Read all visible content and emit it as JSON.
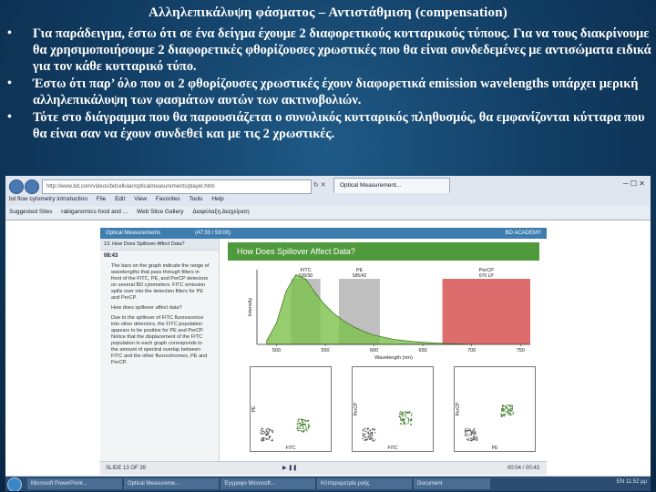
{
  "slide": {
    "title": "Αλληλεπικάλυψη φάσματος – Αντιστάθμιση (compensation)",
    "bullets": [
      "Για παράδειγμα, έστω ότι σε ένα δείγμα έχουμε 2 διαφορετικούς κυτταρικούς τύπους. Για να τους διακρίνουμε θα χρησιμοποιήσουμε 2 διαφορετικές φθορίζουσες χρωστικές που θα είναι συνδεδεμένες με αντισώματα ειδικά για τον κάθε κυτταρικό τύπο.",
      "Έστω ότι παρ’ όλο που οι 2 φθορίζουσες χρωστικές έχουν διαφορετικά emission wavelengths υπάρχει μερική αλληλεπικάλυψη των φασμάτων αυτών των ακτινοβολιών.",
      "Τότε στο διάγραμμα που θα παρουσιάζεται ο συνολικός κυτταρικός πληθυσμός, θα εμφανίζονται κύτταρα που θα είναι σαν να έχουν συνδεθεί και με τις 2 χρωστικές."
    ],
    "bullet_glyph": "•"
  },
  "browser": {
    "url": "http://www.bd.com/videos/bdcellular/opticalmeasurements/player.html",
    "tab_label": "Optical Measurement...",
    "menu": [
      "File",
      "Edit",
      "View",
      "Favorites",
      "Tools",
      "Help"
    ],
    "search_text": "bd flow cytometry introduction",
    "favorites": [
      "Suggested Sites",
      "rabiganomics food and ...",
      "Web Slice Gallery",
      "Διαφύλαξη Διαχείριση"
    ]
  },
  "course": {
    "header_left": "Optical Measurements",
    "header_mid": "(47:33 / 59:00)",
    "header_right": "BD ACADEMY",
    "slide_title": "13. How Does Spillover Affect Data?",
    "time": "08:43",
    "paragraphs": [
      "The bars on the graph indicate the range of wavelengths that pass through filters in front of the FITC, PE, and PerCP detectors on several BD cytometers. FITC emission spills over into the detection filters for PE and PerCP.",
      "How does spillover affect data?",
      "Due to the spillover of FITC fluorescence into other detectors, the FITC population appears to be positive for PE and PerCP. Notice that the displacement of the FITC population in each graph corresponds to the amount of spectral overlap between FITC and the other fluorochromes, PE and PerCP."
    ],
    "banner_title": "How Does Spillover Affect Data?",
    "status_left": "SLIDE 13 OF 39",
    "status_right": "00:04 / 00:43"
  },
  "chart_data": {
    "type": "area",
    "title": "",
    "xlabel": "Wavelength (nm)",
    "ylabel": "Intensity",
    "x_ticks": [
      500,
      550,
      600,
      650,
      700,
      750
    ],
    "xlim": [
      480,
      760
    ],
    "filters": [
      {
        "name": "FITC",
        "label2": "530/30",
        "range": [
          515,
          545
        ]
      },
      {
        "name": "PE",
        "label2": "585/42",
        "range": [
          564,
          606
        ]
      },
      {
        "name": "PerCP",
        "label2": "670 LP",
        "range": [
          670,
          760
        ]
      }
    ],
    "series": [
      {
        "name": "FITC",
        "x": [
          490,
          500,
          510,
          520,
          530,
          540,
          550,
          560,
          570,
          580,
          590,
          600,
          620,
          640,
          660,
          680,
          700
        ],
        "y": [
          0.05,
          0.3,
          0.75,
          0.98,
          0.92,
          0.72,
          0.55,
          0.42,
          0.32,
          0.24,
          0.18,
          0.13,
          0.07,
          0.04,
          0.02,
          0.01,
          0.0
        ]
      }
    ],
    "colors": {
      "fitc": "#7cc04a",
      "filter": "#8a8a8a",
      "percp": "#d23b3b"
    }
  },
  "dotplots": [
    {
      "ylabel": "PE",
      "xlabel": "FITC"
    },
    {
      "ylabel": "PerCP",
      "xlabel": "FITC"
    },
    {
      "ylabel": "PerCP",
      "xlabel": "PE"
    }
  ],
  "taskbar": {
    "items": [
      "Microsoft PowerPoint...",
      "Optical Measureme...",
      "Έγγραφο Microsoft...",
      "Κύτταρομετρία ροής",
      "Document"
    ],
    "tray": "EN  11:52 μμ"
  }
}
